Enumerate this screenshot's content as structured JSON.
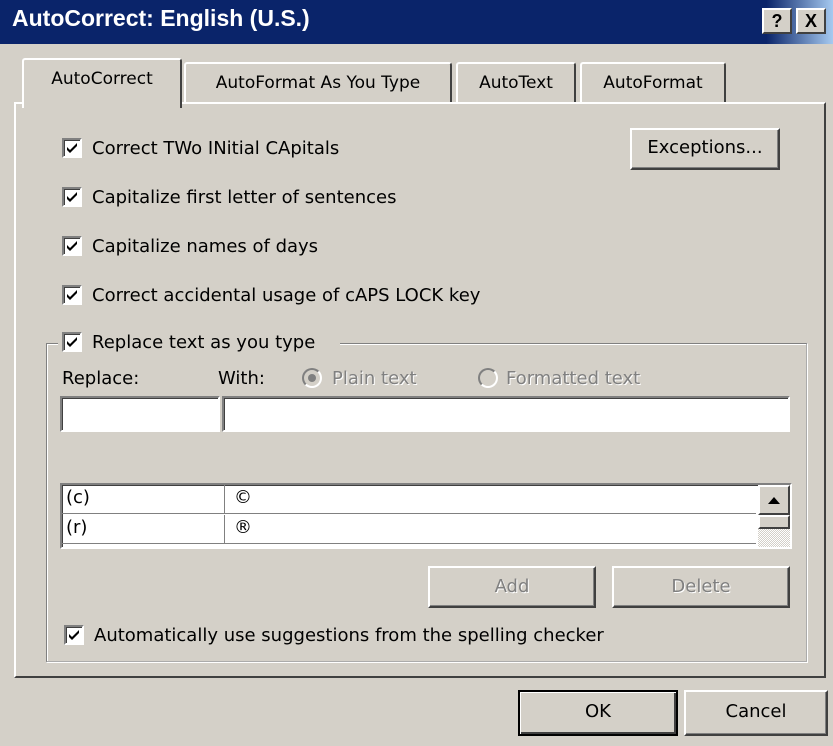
{
  "window": {
    "title": "AutoCorrect: English (U.S.)",
    "help_label": "?",
    "close_label": "X"
  },
  "tabs": [
    {
      "label": "AutoCorrect",
      "active": true
    },
    {
      "label": "AutoFormat As You Type",
      "active": false
    },
    {
      "label": "AutoText",
      "active": false
    },
    {
      "label": "AutoFormat",
      "active": false
    }
  ],
  "options": {
    "correct_two_initial_capitals": {
      "label": "Correct TWo INitial CApitals",
      "checked": true
    },
    "capitalize_first_letter": {
      "label": "Capitalize first letter of sentences",
      "checked": true
    },
    "capitalize_days": {
      "label": "Capitalize names of days",
      "checked": true
    },
    "caps_lock": {
      "label": "Correct accidental usage of cAPS LOCK key",
      "checked": true
    },
    "replace_text": {
      "label": "Replace text as you type",
      "checked": true
    },
    "use_suggestions": {
      "label": "Automatically use suggestions from the spelling checker",
      "checked": true
    }
  },
  "exceptions_button": "Exceptions...",
  "replace_group": {
    "replace_label": "Replace:",
    "with_label": "With:",
    "plain_text_label": "Plain text",
    "formatted_text_label": "Formatted text",
    "replace_value": "",
    "with_value": "",
    "list": [
      {
        "replace": "(c)",
        "with": "©"
      },
      {
        "replace": "(r)",
        "with": "®"
      }
    ],
    "add_label": "Add",
    "delete_label": "Delete"
  },
  "footer": {
    "ok_label": "OK",
    "cancel_label": "Cancel"
  }
}
